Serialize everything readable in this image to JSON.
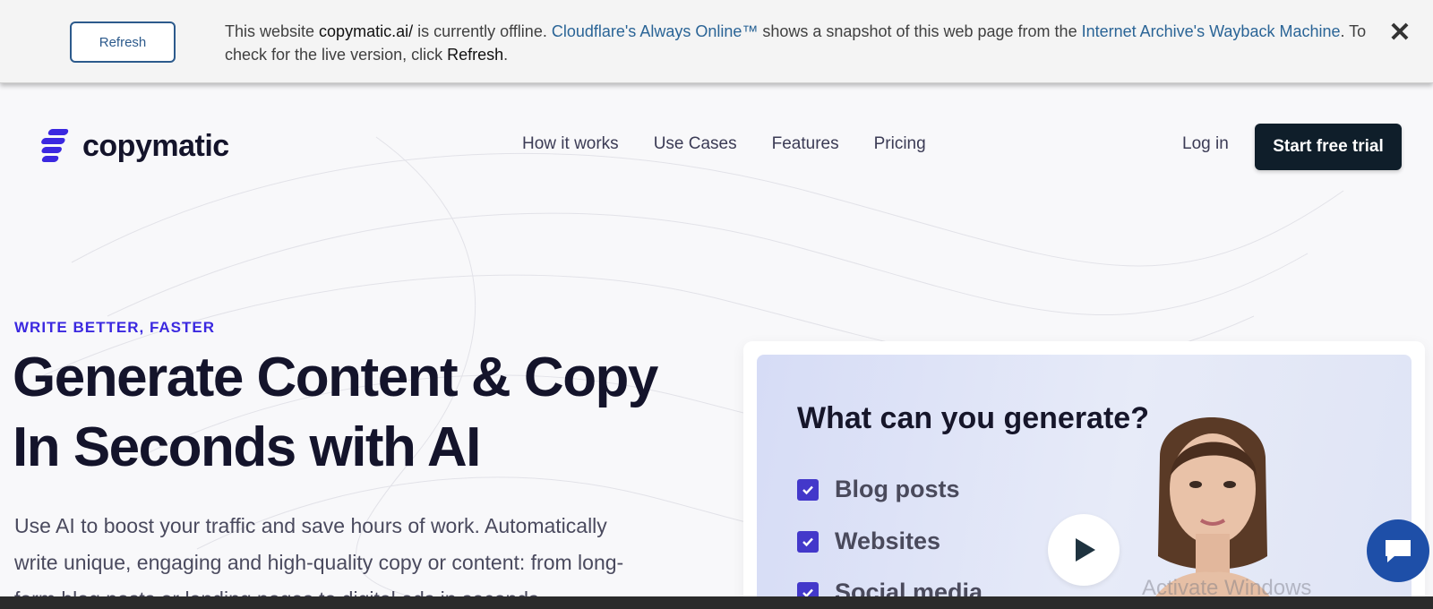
{
  "banner": {
    "refresh_label": "Refresh",
    "msg_part1": "This website ",
    "site": "copymatic.ai/",
    "msg_part2": " is currently offline. ",
    "link1": "Cloudflare's Always Online™",
    "msg_part3": " shows a snapshot of this web page from the ",
    "link2": "Internet Archive's Wayback Machine",
    "msg_part4": ". To check for the live version, click ",
    "refresh_word": "Refresh",
    "msg_end": ".",
    "close_icon": "close-icon"
  },
  "nav": {
    "logo_text": "copymatic",
    "links": [
      "How it works",
      "Use Cases",
      "Features",
      "Pricing"
    ],
    "login": "Log in",
    "cta": "Start free trial"
  },
  "hero": {
    "eyebrow": "WRITE BETTER, FASTER",
    "title_line1": "Generate Content & Copy",
    "title_line2": "In Seconds with AI",
    "subtitle": "Use AI to boost your traffic and save hours of work. Automatically write unique, engaging and high-quality copy or content: from long-form blog posts or landing pages to digital ads in seconds."
  },
  "video": {
    "heading": "What can you generate?",
    "items": [
      "Blog posts",
      "Websites",
      "Social media"
    ],
    "play_icon": "play-icon"
  },
  "watermark": "Activate Windows",
  "chat_icon": "chat-icon",
  "colors": {
    "brand": "#3b28e0",
    "cta_bg": "#0f1e2a",
    "check": "#4338ca",
    "banner_link": "#2a6496",
    "chat": "#1e4fa8"
  }
}
